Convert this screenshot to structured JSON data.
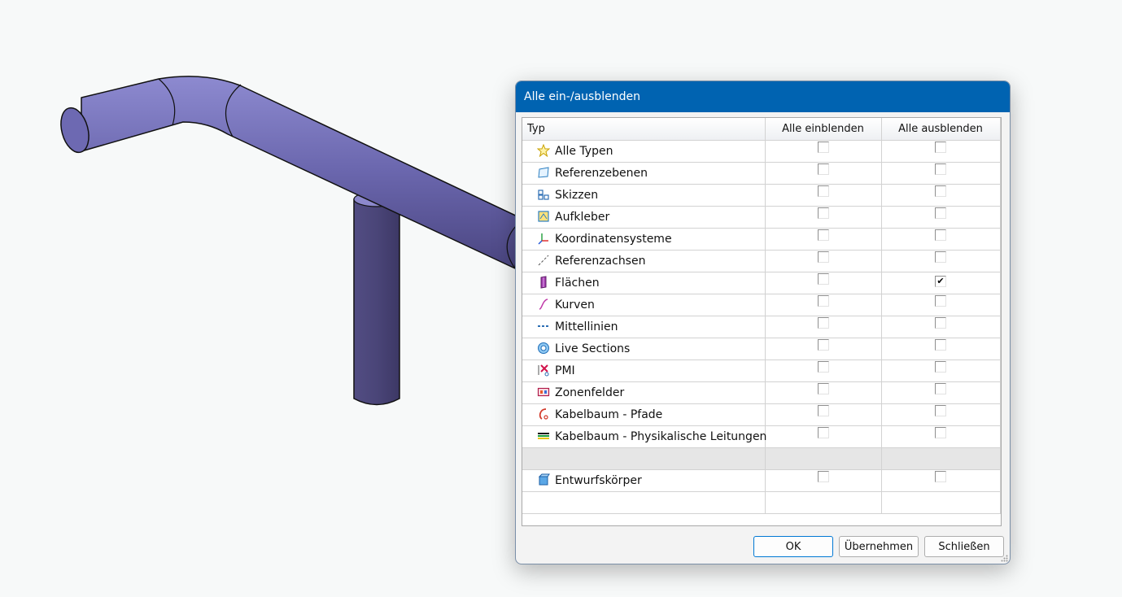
{
  "dialog": {
    "title": "Alle ein-/ausblenden",
    "columns": {
      "type": "Typ",
      "show_all": "Alle einblenden",
      "hide_all": "Alle ausblenden"
    },
    "rows": [
      {
        "label": "Alle Typen",
        "icon": "star-icon",
        "show": false,
        "hide": false
      },
      {
        "label": "Referenzebenen",
        "icon": "datum-plane-icon",
        "show": false,
        "hide": false
      },
      {
        "label": "Skizzen",
        "icon": "sketch-icon",
        "show": false,
        "hide": false
      },
      {
        "label": "Aufkleber",
        "icon": "decal-icon",
        "show": false,
        "hide": false
      },
      {
        "label": "Koordinatensysteme",
        "icon": "coordinate-system-icon",
        "show": false,
        "hide": false
      },
      {
        "label": "Referenzachsen",
        "icon": "datum-axis-icon",
        "show": false,
        "hide": false
      },
      {
        "label": "Flächen",
        "icon": "surface-icon",
        "show": false,
        "hide": true
      },
      {
        "label": "Kurven",
        "icon": "curve-icon",
        "show": false,
        "hide": false
      },
      {
        "label": "Mittellinien",
        "icon": "centerline-icon",
        "show": false,
        "hide": false
      },
      {
        "label": "Live Sections",
        "icon": "live-section-icon",
        "show": false,
        "hide": false
      },
      {
        "label": "PMI",
        "icon": "pmi-icon",
        "show": false,
        "hide": false
      },
      {
        "label": "Zonenfelder",
        "icon": "zone-icon",
        "show": false,
        "hide": false
      },
      {
        "label": "Kabelbaum - Pfade",
        "icon": "harness-path-icon",
        "show": false,
        "hide": false
      },
      {
        "label": "Kabelbaum - Physikalische Leitungen",
        "icon": "harness-wire-icon",
        "show": false,
        "hide": false
      }
    ],
    "bodies_row": {
      "label": "Entwurfskörper",
      "icon": "design-body-icon",
      "show": false,
      "hide": false
    },
    "buttons": {
      "ok": "OK",
      "apply": "Übernehmen",
      "close": "Schließen"
    }
  },
  "colors": {
    "titlebar": "#0063b1",
    "pipe": "#6c68b0",
    "pipe_dark": "#45406e"
  }
}
